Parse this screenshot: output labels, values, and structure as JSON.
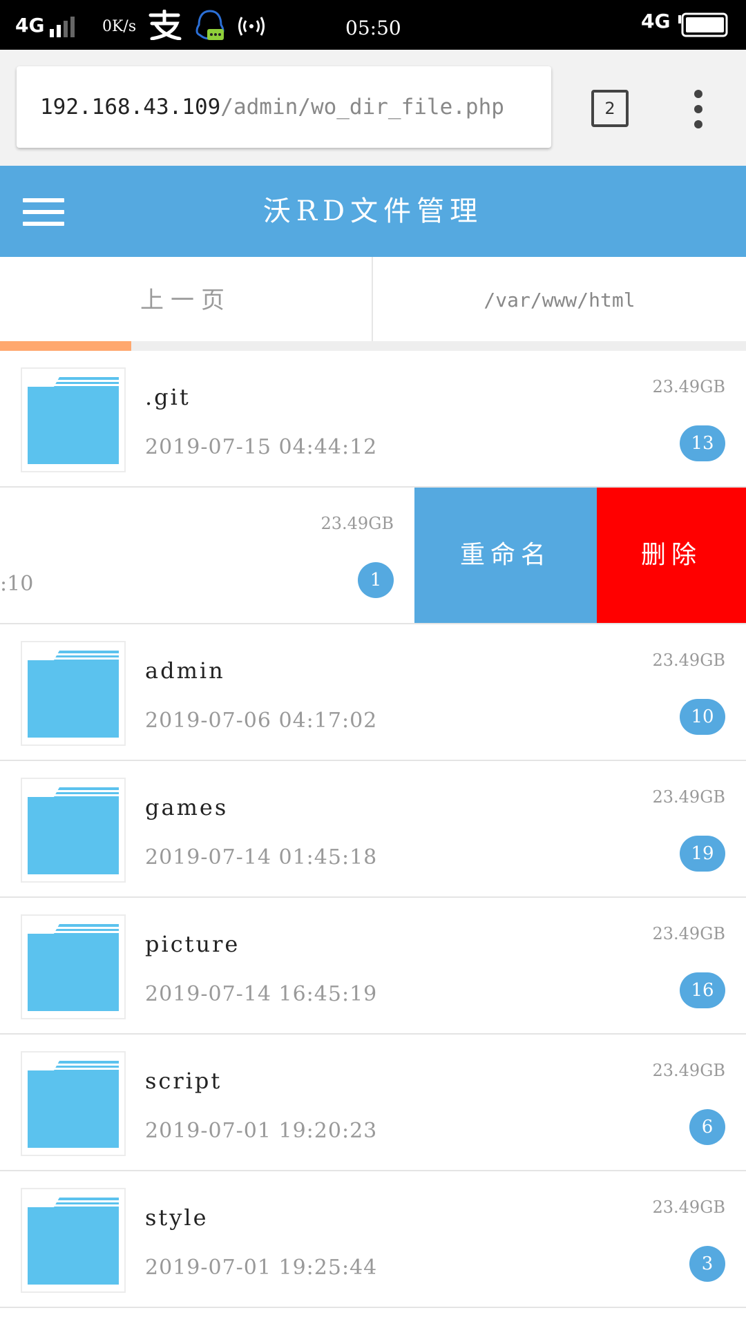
{
  "status_bar": {
    "network_left": "4G",
    "speed": "0K/s",
    "time": "05:50",
    "network_right": "4G"
  },
  "browser": {
    "url_host": "192.168.43.109",
    "url_path": "/admin/wo_dir_file.php",
    "tab_count": "2"
  },
  "header": {
    "title": "沃RD文件管理"
  },
  "nav": {
    "back_label": "上一页",
    "current_path": "/var/www/html"
  },
  "progress": {
    "value_percent": 17.6,
    "color": "#ffa86f"
  },
  "colors": {
    "accent": "#55a9e0",
    "danger": "#ff0000",
    "folder": "#5bc2ee"
  },
  "files": [
    {
      "name": ".git",
      "date": "2019-07-15 04:44:12",
      "size": "23.49GB",
      "count": "13",
      "icon": "folder-icon"
    },
    {
      "name": "admin",
      "date": "2019-07-06 04:17:02",
      "size": "23.49GB",
      "count": "10",
      "icon": "folder-icon"
    },
    {
      "name": "games",
      "date": "2019-07-14 01:45:18",
      "size": "23.49GB",
      "count": "19",
      "icon": "folder-icon"
    },
    {
      "name": "picture",
      "date": "2019-07-14 16:45:19",
      "size": "23.49GB",
      "count": "16",
      "icon": "folder-icon"
    },
    {
      "name": "script",
      "date": "2019-07-01 19:20:23",
      "size": "23.49GB",
      "count": "6",
      "icon": "folder-icon"
    },
    {
      "name": "style",
      "date": "2019-07-01 19:25:44",
      "size": "23.49GB",
      "count": "3",
      "icon": "folder-icon"
    }
  ],
  "swiped_row": {
    "date_fragment": ":10",
    "size": "23.49GB",
    "count": "1",
    "rename_label": "重命名",
    "delete_label": "删除"
  }
}
